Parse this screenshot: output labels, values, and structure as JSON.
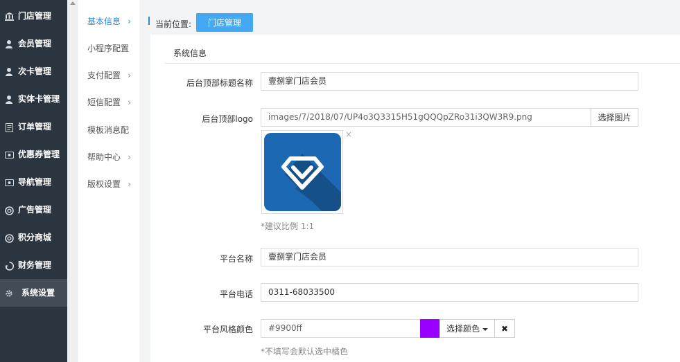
{
  "sidebar": {
    "items": [
      {
        "label": "门店管理",
        "icon": "bank-icon"
      },
      {
        "label": "会员管理",
        "icon": "user-icon"
      },
      {
        "label": "次卡管理",
        "icon": "user-icon"
      },
      {
        "label": "实体卡管理",
        "icon": "user-icon"
      },
      {
        "label": "订单管理",
        "icon": "document-icon"
      },
      {
        "label": "优惠券管理",
        "icon": "ticket-icon"
      },
      {
        "label": "导航管理",
        "icon": "ticket-icon"
      },
      {
        "label": "广告管理",
        "icon": "lifebuoy-icon"
      },
      {
        "label": "积分商城",
        "icon": "lifebuoy-icon"
      },
      {
        "label": "财务管理",
        "icon": "recycle-icon"
      },
      {
        "label": "系统设置",
        "icon": "gear-icon"
      }
    ],
    "active_index": 10
  },
  "subnav": {
    "items": [
      {
        "label": "基本信息",
        "chevron": true
      },
      {
        "label": "小程序配置",
        "chevron": false
      },
      {
        "label": "支付配置",
        "chevron": true
      },
      {
        "label": "短信配置",
        "chevron": true
      },
      {
        "label": "模板消息配",
        "chevron": false
      },
      {
        "label": "帮助中心",
        "chevron": true
      },
      {
        "label": "版权设置",
        "chevron": true
      }
    ],
    "active_index": 0
  },
  "breadcrumb": {
    "label": "当前位置:",
    "current": "门店管理"
  },
  "section": {
    "title": "系统信息"
  },
  "form": {
    "header_title": {
      "label": "后台顶部标题名称",
      "value": "壹捌掌门店会员"
    },
    "header_logo": {
      "label": "后台顶部logo",
      "value": "images/7/2018/07/UP4o3Q3315H51gQQQpZRo31i3QW3R9.png",
      "button": "选择图片",
      "remove": "×",
      "hint": "*建议比例 1:1"
    },
    "platform_name": {
      "label": "平台名称",
      "value": "壹捌掌门店会员"
    },
    "platform_phone": {
      "label": "平台电话",
      "value": "0311-68033500"
    },
    "platform_color": {
      "label": "平台风格颜色",
      "value": "#9900ff",
      "swatch": "#9900ff",
      "button": "选择颜色",
      "clear": "✖",
      "hint": "*不填写会默认选中橘色"
    }
  },
  "colors": {
    "sidebar_bg": "#2b3540",
    "accent": "#2a8ad9",
    "crumb_button": "#44a8f2"
  }
}
